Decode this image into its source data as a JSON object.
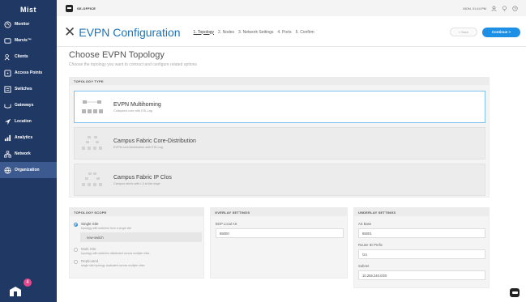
{
  "sidebar": {
    "logo": "Mist",
    "badge_count": "4",
    "items": [
      {
        "label": "Monitor",
        "icon": "monitor-icon"
      },
      {
        "label": "Marvis™",
        "icon": "marvis-icon"
      },
      {
        "label": "Clients",
        "icon": "clients-icon"
      },
      {
        "label": "Access Points",
        "icon": "access-point-icon"
      },
      {
        "label": "Switches",
        "icon": "switch-icon"
      },
      {
        "label": "Gateways",
        "icon": "gateway-icon"
      },
      {
        "label": "Location",
        "icon": "location-icon"
      },
      {
        "label": "Analytics",
        "icon": "analytics-icon"
      },
      {
        "label": "Network",
        "icon": "network-icon"
      },
      {
        "label": "Organization",
        "icon": "organization-icon"
      }
    ],
    "active_index": 9
  },
  "topbar": {
    "site_name": "SE-OFFICE",
    "datetime": "MON, 01:44 PM"
  },
  "header": {
    "title": "EVPN Configuration",
    "steps": [
      "1. Topology",
      "2. Nodes",
      "3. Network Settings",
      "4. Ports",
      "5. Confirm"
    ],
    "current_step": 0,
    "back_label": "< Back",
    "continue_label": "Continue >"
  },
  "main": {
    "title": "Choose EVPN Topology",
    "subtitle": "Choose the topology you want to contruct and configure related options",
    "topology_header": "TOPOLOGY TYPE",
    "topologies": [
      {
        "name": "EVPN Multihoming",
        "desc": "Collapsed core with ESI-Lag",
        "selected": true
      },
      {
        "name": "Campus Fabric Core-Distribution",
        "desc": "EVPN core/distribution with ESI-Lag",
        "selected": false
      },
      {
        "name": "Campus Fabric IP Clos",
        "desc": "Campus fabric with L3 at the edge",
        "selected": false
      }
    ]
  },
  "scope": {
    "header": "TOPOLOGY SCOPE",
    "options": [
      {
        "label": "Single Site",
        "desc": "topology with switches from a single site",
        "selected": true
      },
      {
        "label": "Multi Site",
        "desc": "topology with switches distributed across multiple sites",
        "selected": false
      },
      {
        "label": "Replicated",
        "desc": "single site topology replicated across multiple sites",
        "selected": false
      }
    ],
    "switch_value": "new-switch"
  },
  "overlay": {
    "header": "OVERLAY SETTINGS",
    "bgp_label": "BGP Local AS",
    "bgp_value": "65000"
  },
  "underlay": {
    "header": "UNDERLAY SETTINGS",
    "as_base_label": "AS Base",
    "as_base_value": "65001",
    "router_prefix_label": "Router ID Prefix",
    "router_prefix_value": "/24",
    "subnet_label": "Subnet",
    "subnet_value": "10.255.240.0/20"
  },
  "colors": {
    "sidebar": "#203864",
    "accent": "#1d8fe4",
    "title": "#1a73b8",
    "badge": "#e8478b"
  }
}
